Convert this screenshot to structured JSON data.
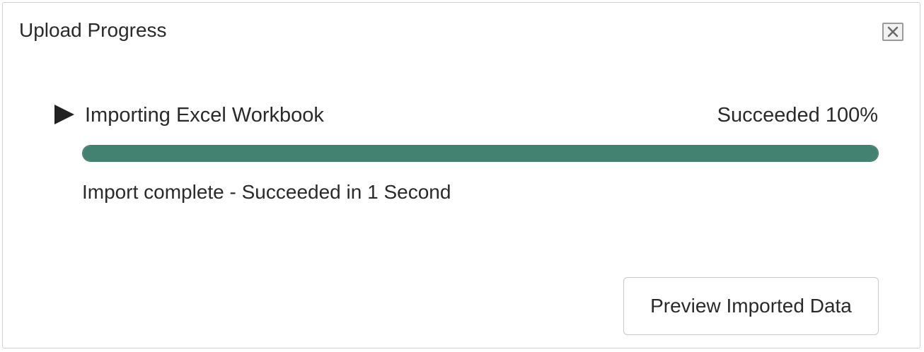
{
  "dialog": {
    "title": "Upload Progress",
    "close_icon": "close-icon"
  },
  "task": {
    "expand_icon": "play-triangle-icon",
    "label": "Importing Excel Workbook",
    "status": "Succeeded 100%",
    "progress": 1.0
  },
  "message": "Import complete - Succeeded in 1 Second",
  "actions": {
    "preview_label": "Preview Imported Data"
  },
  "colors": {
    "progress_fill": "#438171",
    "text": "#2a2a2a",
    "border": "#cfcfcf"
  }
}
